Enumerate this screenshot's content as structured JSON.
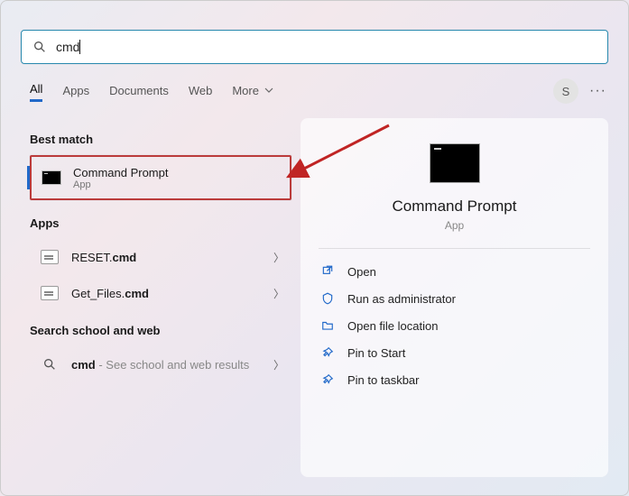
{
  "search": {
    "value": "cmd",
    "placeholder": ""
  },
  "tabs": {
    "all": "All",
    "apps": "Apps",
    "documents": "Documents",
    "web": "Web",
    "more": "More"
  },
  "user": {
    "initial": "S"
  },
  "sections": {
    "best_match": "Best match",
    "apps": "Apps",
    "search_web": "Search school and web"
  },
  "best_match_item": {
    "title": "Command Prompt",
    "subtitle": "App"
  },
  "app_results": [
    {
      "title_pre": "RESET.",
      "title_bold": "cmd"
    },
    {
      "title_pre": "Get_Files.",
      "title_bold": "cmd"
    }
  ],
  "web_result": {
    "bold": "cmd",
    "rest": " - See school and web results"
  },
  "details": {
    "title": "Command Prompt",
    "subtitle": "App",
    "actions": {
      "open": "Open",
      "run_admin": "Run as administrator",
      "open_loc": "Open file location",
      "pin_start": "Pin to Start",
      "pin_taskbar": "Pin to taskbar"
    }
  },
  "colors": {
    "accent": "#2169c9",
    "highlight_border": "#bb3b3b"
  }
}
